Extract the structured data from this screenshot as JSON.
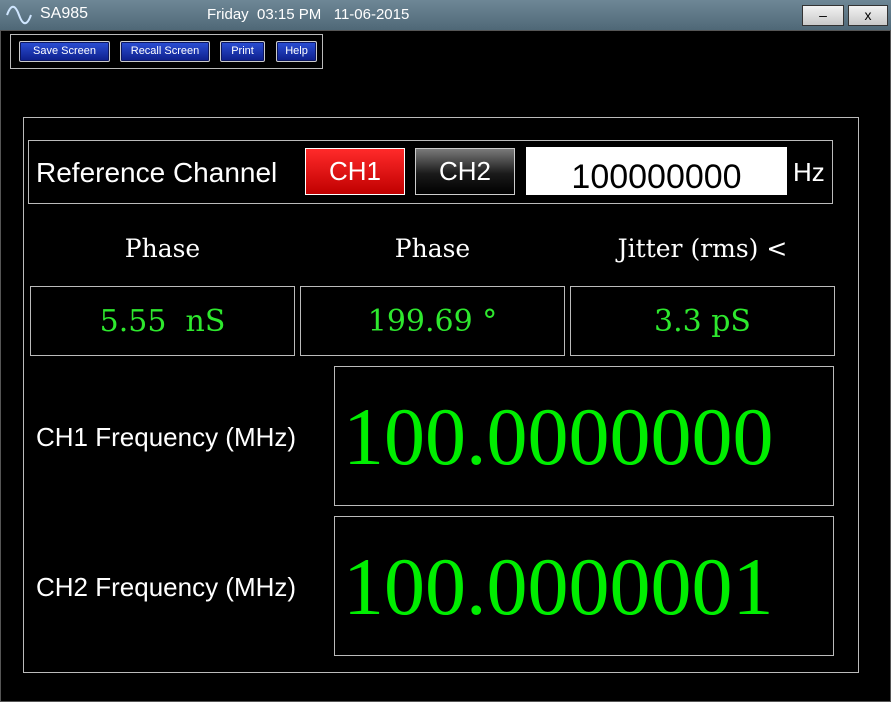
{
  "titlebar": {
    "app_name": "SA985",
    "datetime": "Friday  03:15 PM   11-06-2015",
    "minimize_label": "–",
    "close_label": "x"
  },
  "toolbar": {
    "save_screen": "Save Screen",
    "recall_screen": "Recall Screen",
    "print": "Print",
    "help": "Help"
  },
  "reference": {
    "label": "Reference Channel",
    "ch1": "CH1",
    "ch2": "CH2",
    "selected": "CH1",
    "frequency_value": "100000000",
    "unit": "Hz"
  },
  "measurements": [
    {
      "label": "Phase",
      "value": "5.55  nS"
    },
    {
      "label": "Phase",
      "value": "199.69 °"
    },
    {
      "label": "Jitter (rms) <",
      "value": "3.3 pS"
    }
  ],
  "frequencies": [
    {
      "label": "CH1 Frequency (MHz)",
      "value": "100.0000000"
    },
    {
      "label": "CH2 Frequency (MHz)",
      "value": "100.0000001"
    }
  ],
  "colors": {
    "readout_green": "#00ee00",
    "active_channel": "#e00000",
    "toolbar_button": "#1a35b8"
  }
}
